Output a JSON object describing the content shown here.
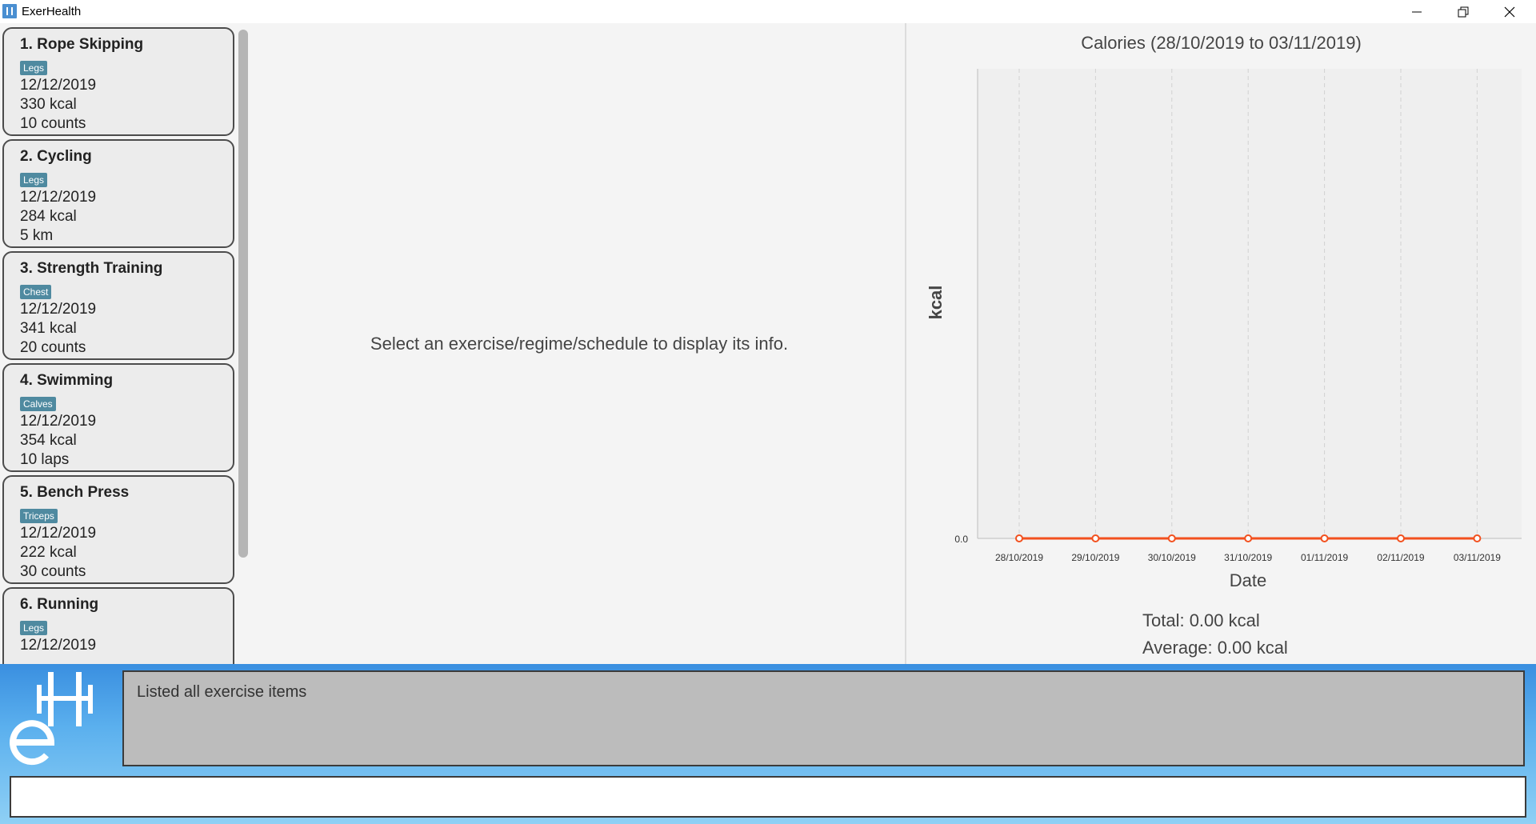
{
  "window": {
    "title": "ExerHealth"
  },
  "exercises": [
    {
      "title": "1.  Rope Skipping",
      "tag": "Legs",
      "date": "12/12/2019",
      "calories": "330 kcal",
      "quantity": "10 counts"
    },
    {
      "title": "2.  Cycling",
      "tag": "Legs",
      "date": "12/12/2019",
      "calories": "284 kcal",
      "quantity": "5 km"
    },
    {
      "title": "3.  Strength Training",
      "tag": "Chest",
      "date": "12/12/2019",
      "calories": "341 kcal",
      "quantity": "20 counts"
    },
    {
      "title": "4.  Swimming",
      "tag": "Calves",
      "date": "12/12/2019",
      "calories": "354 kcal",
      "quantity": "10 laps"
    },
    {
      "title": "5.  Bench Press",
      "tag": "Triceps",
      "date": "12/12/2019",
      "calories": "222 kcal",
      "quantity": "30 counts"
    },
    {
      "title": "6.  Running",
      "tag": "Legs",
      "date": "12/12/2019",
      "calories": "",
      "quantity": ""
    }
  ],
  "info_panel": {
    "placeholder": "Select an exercise/regime/schedule to display its info."
  },
  "chart_data": {
    "type": "line",
    "title": "Calories (28/10/2019 to 03/11/2019)",
    "xlabel": "Date",
    "ylabel": "kcal",
    "categories": [
      "28/10/2019",
      "29/10/2019",
      "30/10/2019",
      "31/10/2019",
      "01/11/2019",
      "02/11/2019",
      "03/11/2019"
    ],
    "series": [
      {
        "values": [
          0,
          0,
          0,
          0,
          0,
          0,
          0
        ]
      }
    ],
    "y_ticks": [
      "0.0"
    ],
    "grid": true,
    "line_color": "#f2501e"
  },
  "stats": {
    "total": "Total: 0.00 kcal",
    "average": "Average: 0.00 kcal"
  },
  "result": {
    "message": "Listed all exercise items"
  },
  "command": {
    "value": "",
    "placeholder": ""
  }
}
